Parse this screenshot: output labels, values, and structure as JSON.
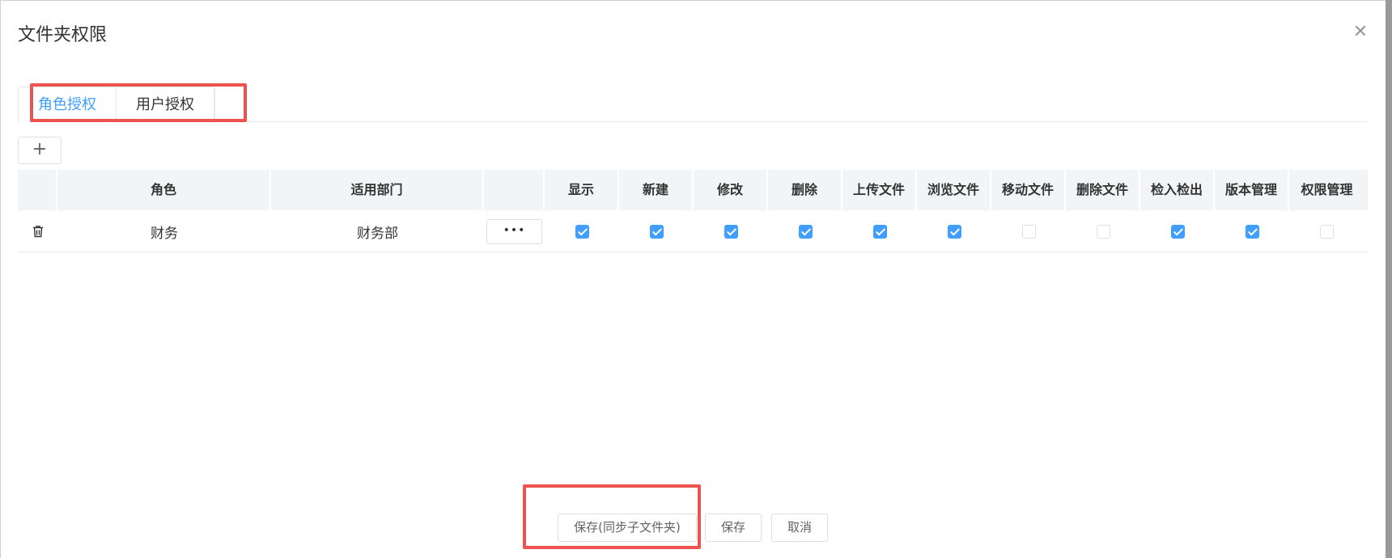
{
  "dialog": {
    "title": "文件夹权限",
    "close_icon": "close-icon"
  },
  "tabs": [
    {
      "label": "角色授权",
      "active": true
    },
    {
      "label": "用户授权",
      "active": false
    }
  ],
  "toolbar": {
    "add_label": "+"
  },
  "table": {
    "headers": {
      "role": "角色",
      "dept": "适用部门",
      "perms": [
        "显示",
        "新建",
        "修改",
        "删除",
        "上传文件",
        "浏览文件",
        "移动文件",
        "删除文件",
        "检入检出",
        "版本管理",
        "权限管理"
      ]
    },
    "rows": [
      {
        "role": "财务",
        "dept": "财务部",
        "more_label": "•••",
        "perms": [
          true,
          true,
          true,
          true,
          true,
          true,
          false,
          false,
          true,
          true,
          false
        ]
      }
    ]
  },
  "footer": {
    "sync_save_label": "保存(同步子文件夹)",
    "save_label": "保存",
    "cancel_label": "取消"
  },
  "colors": {
    "accent": "#409eff",
    "highlight": "#ef5350"
  }
}
